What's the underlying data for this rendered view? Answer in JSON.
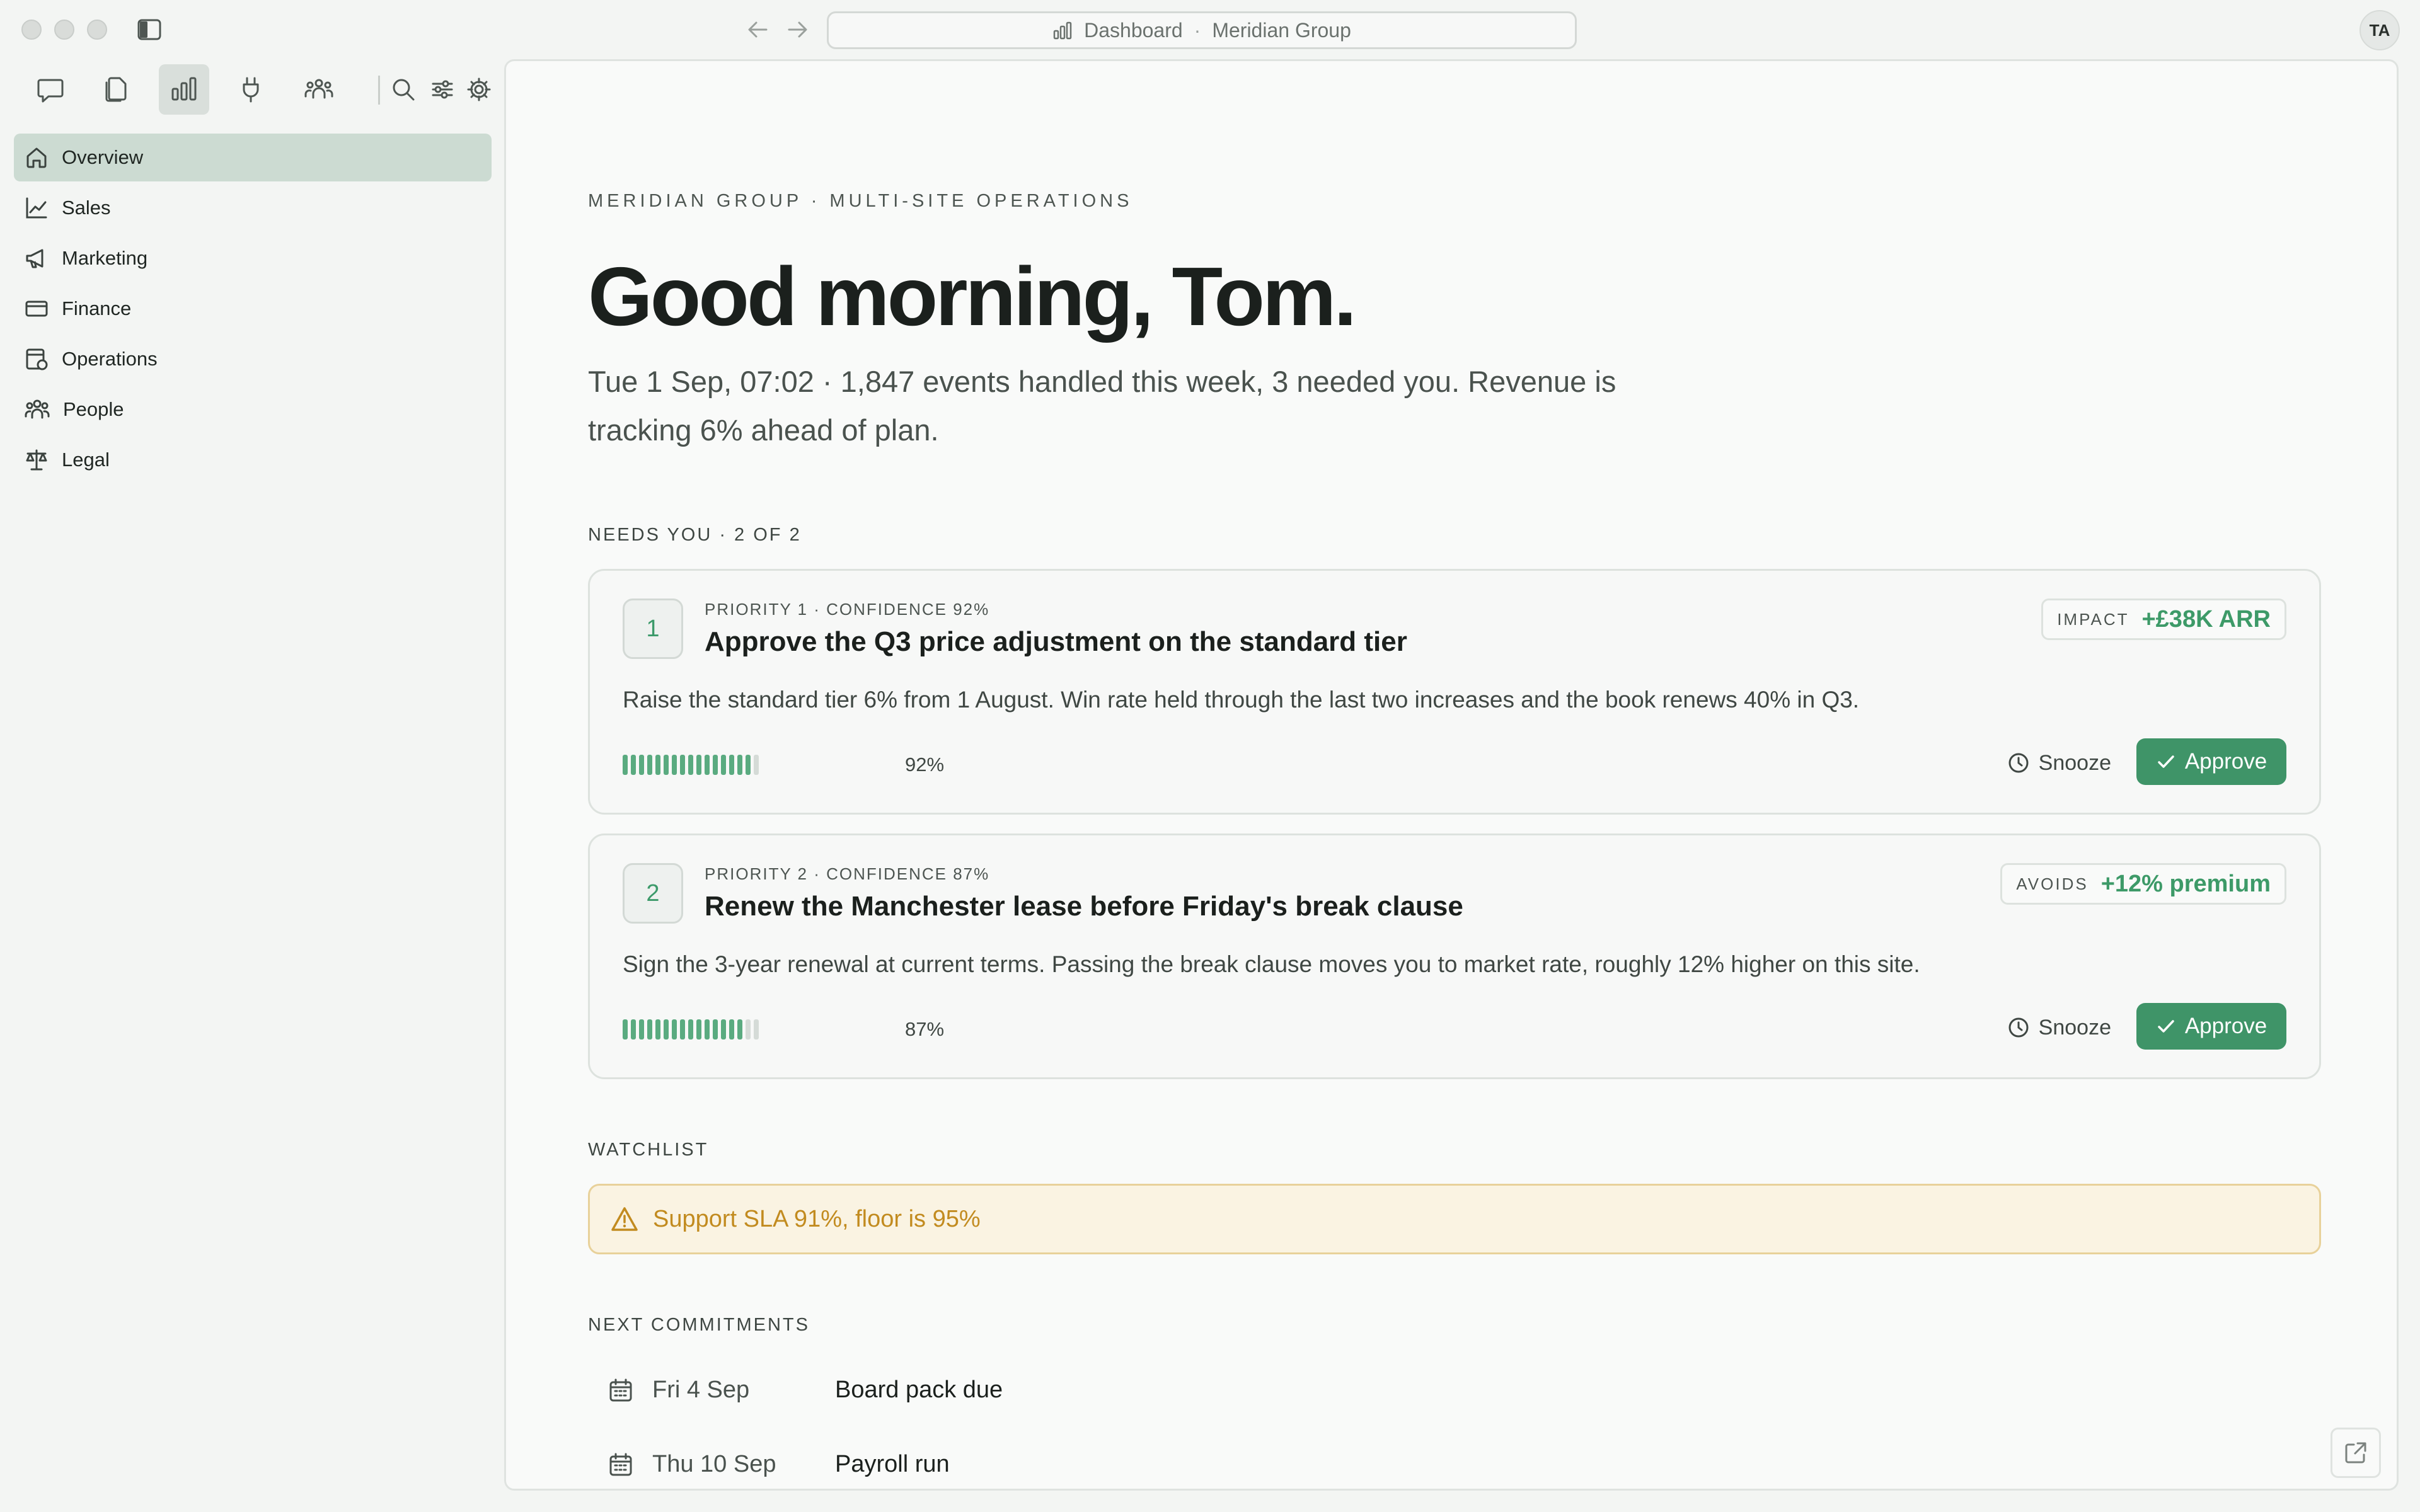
{
  "window": {
    "address": {
      "page": "Dashboard",
      "separator": "·",
      "org": "Meridian Group"
    },
    "avatar_initials": "TA"
  },
  "toolbar": {
    "icons": [
      "chat-icon",
      "documents-icon",
      "chart-icon",
      "plug-icon",
      "team-icon",
      "search-icon",
      "sliders-icon",
      "gear-icon"
    ],
    "active": "chart-icon"
  },
  "sidebar": {
    "items": [
      {
        "label": "Overview",
        "icon": "home-icon",
        "active": true
      },
      {
        "label": "Sales",
        "icon": "trend-icon",
        "active": false
      },
      {
        "label": "Marketing",
        "icon": "megaphone-icon",
        "active": false
      },
      {
        "label": "Finance",
        "icon": "card-icon",
        "active": false
      },
      {
        "label": "Operations",
        "icon": "operations-icon",
        "active": false
      },
      {
        "label": "People",
        "icon": "people-icon",
        "active": false
      },
      {
        "label": "Legal",
        "icon": "scales-icon",
        "active": false
      }
    ]
  },
  "main": {
    "eyebrow": "MERIDIAN GROUP · MULTI-SITE OPERATIONS",
    "greeting": "Good morning, Tom.",
    "summary": "Tue 1 Sep, 07:02 · 1,847 events handled this week, 3 needed you. Revenue is tracking 6% ahead of plan.",
    "needs_label": "NEEDS YOU · 2 OF 2",
    "cards": [
      {
        "rank": "1",
        "meta": "PRIORITY 1 · CONFIDENCE 92%",
        "title": "Approve the Q3 price adjustment on the standard tier",
        "desc": "Raise the standard tier 6% from 1 August. Win rate held through the last two increases and the book renews 40% in Q3.",
        "impact_label": "IMPACT",
        "impact_value": "+£38K ARR",
        "confidence": 0.92,
        "confidence_text": "92%",
        "snooze": "Snooze",
        "approve": "Approve"
      },
      {
        "rank": "2",
        "meta": "PRIORITY 2 · CONFIDENCE 87%",
        "title": "Renew the Manchester lease before Friday's break clause",
        "desc": "Sign the 3-year renewal at current terms. Passing the break clause moves you to market rate, roughly 12% higher on this site.",
        "impact_label": "AVOIDS",
        "impact_value": "+12% premium",
        "confidence": 0.87,
        "confidence_text": "87%",
        "snooze": "Snooze",
        "approve": "Approve"
      }
    ],
    "watchlist_label": "WATCHLIST",
    "watchlist_item": "Support SLA 91%, floor is 95%",
    "commitments_label": "NEXT COMMITMENTS",
    "commitments": [
      {
        "date": "Fri 4 Sep",
        "what": "Board pack due"
      },
      {
        "date": "Thu 10 Sep",
        "what": "Payroll run"
      }
    ]
  },
  "colors": {
    "accent": "#3f9468",
    "warning": "#c28b1f",
    "warning_bg": "#faf3e2"
  }
}
